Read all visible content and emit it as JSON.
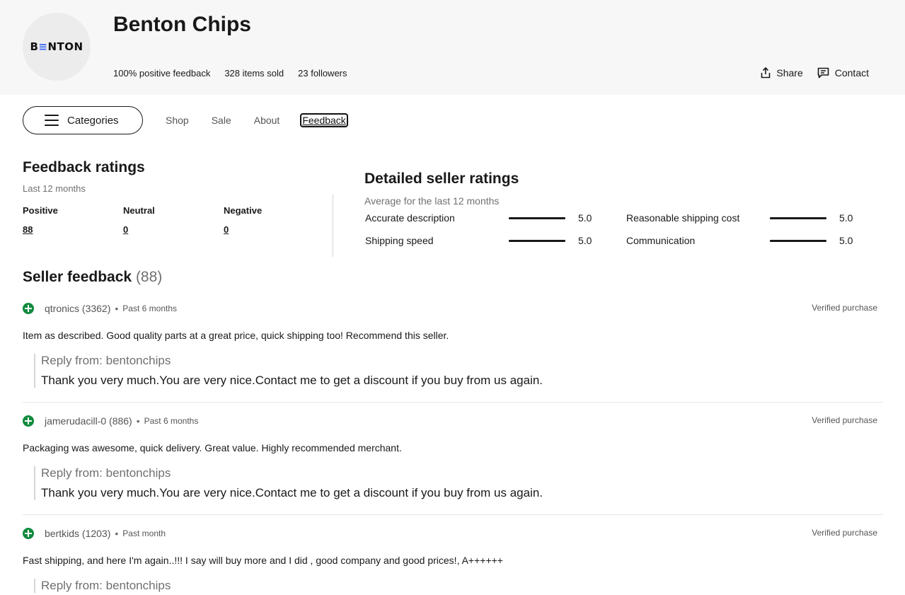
{
  "store": {
    "logo_text_pre": "B",
    "logo_text_accent": "≡",
    "logo_text_post": "NTON",
    "name": "Benton Chips",
    "positive_feedback": "100% positive feedback",
    "items_sold": "328 items sold",
    "followers": "23 followers"
  },
  "actions": {
    "share_label": "Share",
    "contact_label": "Contact"
  },
  "nav": {
    "categories_label": "Categories",
    "tabs": [
      {
        "label": "Shop"
      },
      {
        "label": "Sale"
      },
      {
        "label": "About"
      },
      {
        "label": "Feedback",
        "active": true
      }
    ]
  },
  "feedback_ratings": {
    "title": "Feedback ratings",
    "period": "Last 12 months",
    "positive_label": "Positive",
    "positive_value": "88",
    "neutral_label": "Neutral",
    "neutral_value": "0",
    "negative_label": "Negative",
    "negative_value": "0"
  },
  "detailed_ratings": {
    "title": "Detailed seller ratings",
    "period": "Average for the last 12 months",
    "items": [
      {
        "name": "Accurate description",
        "score": "5.0",
        "fill": 1.0
      },
      {
        "name": "Reasonable shipping cost",
        "score": "5.0",
        "fill": 1.0
      },
      {
        "name": "Shipping speed",
        "score": "5.0",
        "fill": 1.0
      },
      {
        "name": "Communication",
        "score": "5.0",
        "fill": 1.0
      }
    ]
  },
  "seller_feedback": {
    "title": "Seller feedback",
    "count": "(88)",
    "reviews": [
      {
        "user": "qtronics (3362)",
        "when": "Past 6 months",
        "verified": "Verified purchase",
        "text": "Item as described. Good quality parts at a great price, quick shipping too! Recommend this seller.",
        "reply_from": "Reply from: bentonchips",
        "reply_text": "Thank you very much.You are very nice.Contact me to get a discount if you buy from us again."
      },
      {
        "user": "jamerudacill-0 (886)",
        "when": "Past 6 months",
        "verified": "Verified purchase",
        "text": "Packaging was awesome, quick delivery. Great value. Highly recommended merchant.",
        "reply_from": "Reply from: bentonchips",
        "reply_text": "Thank you very much.You are very nice.Contact me to get a discount if you buy from us again."
      },
      {
        "user": "bertkids (1203)",
        "when": "Past month",
        "verified": "Verified purchase",
        "text": "Fast shipping, and here I'm again..!!! I say will buy more and I did , good company and good prices!, A++++++",
        "reply_from": "Reply from: bentonchips"
      }
    ]
  },
  "colors": {
    "positive_icon": "#118a3e",
    "header_bg": "#f7f7f7",
    "muted_text": "#707070"
  }
}
